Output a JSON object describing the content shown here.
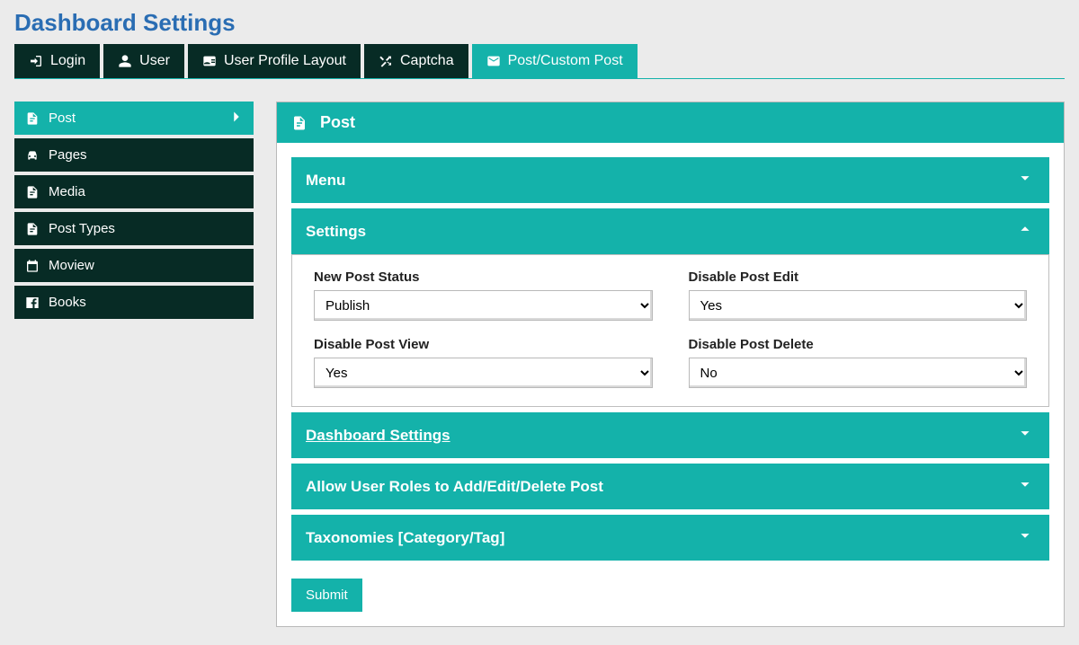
{
  "page_title": "Dashboard Settings",
  "tabs": {
    "login": "Login",
    "user": "User",
    "profile_layout": "User Profile Layout",
    "captcha": "Captcha",
    "post_custom": "Post/Custom Post"
  },
  "sidebar": {
    "items": [
      {
        "label": "Post"
      },
      {
        "label": "Pages"
      },
      {
        "label": "Media"
      },
      {
        "label": "Post Types"
      },
      {
        "label": "Moview"
      },
      {
        "label": "Books"
      }
    ]
  },
  "main": {
    "title": "Post",
    "panels": {
      "menu": "Menu",
      "settings": "Settings",
      "dashboard": "Dashboard Settings",
      "roles": "Allow User Roles to Add/Edit/Delete Post",
      "taxonomies": "Taxonomies [Category/Tag]"
    },
    "form": {
      "new_post_status": {
        "label": "New Post Status",
        "value": "Publish"
      },
      "disable_post_edit": {
        "label": "Disable Post Edit",
        "value": "Yes"
      },
      "disable_post_view": {
        "label": "Disable Post View",
        "value": "Yes"
      },
      "disable_post_delete": {
        "label": "Disable Post Delete",
        "value": "No"
      }
    },
    "submit_label": "Submit"
  }
}
